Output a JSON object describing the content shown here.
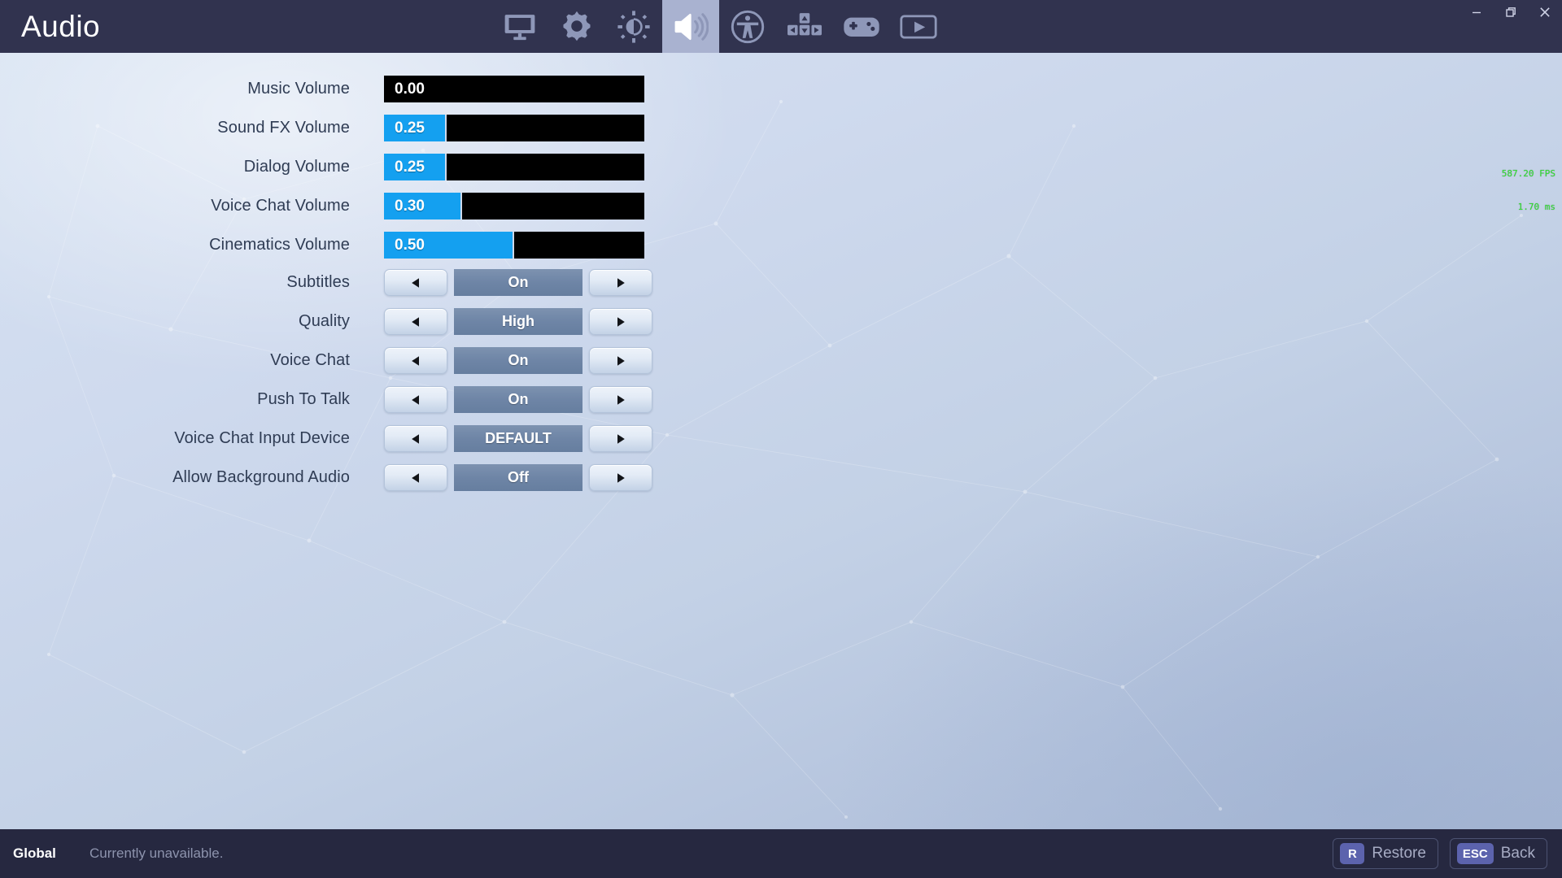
{
  "window": {
    "title": "Audio",
    "controls": [
      {
        "name": "minimize",
        "glyph": "minimize-icon"
      },
      {
        "name": "restore",
        "glyph": "restore-window-icon"
      },
      {
        "name": "close",
        "glyph": "close-icon"
      }
    ]
  },
  "nav": {
    "items": [
      {
        "id": "video",
        "icon": "monitor-icon",
        "active": false
      },
      {
        "id": "graphics",
        "icon": "gear-icon",
        "active": false
      },
      {
        "id": "brightness",
        "icon": "brightness-icon",
        "active": false
      },
      {
        "id": "audio",
        "icon": "speaker-icon",
        "active": true
      },
      {
        "id": "accessibility",
        "icon": "accessibility-icon",
        "active": false
      },
      {
        "id": "keyboard",
        "icon": "keyboard-wasd-icon",
        "active": false
      },
      {
        "id": "controller",
        "icon": "gamepad-icon",
        "active": false
      },
      {
        "id": "replay",
        "icon": "video-play-icon",
        "active": false
      }
    ]
  },
  "settings": {
    "sliders": [
      {
        "label": "Music Volume",
        "value": "0.00",
        "percent": 0
      },
      {
        "label": "Sound FX Volume",
        "value": "0.25",
        "percent": 24
      },
      {
        "label": "Dialog Volume",
        "value": "0.25",
        "percent": 24
      },
      {
        "label": "Voice Chat Volume",
        "value": "0.30",
        "percent": 30
      },
      {
        "label": "Cinematics Volume",
        "value": "0.50",
        "percent": 50
      }
    ],
    "steppers": [
      {
        "label": "Subtitles",
        "value": "On"
      },
      {
        "label": "Quality",
        "value": "High"
      },
      {
        "label": "Voice Chat",
        "value": "On"
      },
      {
        "label": "Push To Talk",
        "value": "On"
      },
      {
        "label": "Voice Chat Input Device",
        "value": "DEFAULT"
      },
      {
        "label": "Allow Background Audio",
        "value": "Off"
      }
    ],
    "prev_arrow": "◀",
    "next_arrow": "▶"
  },
  "overlay": {
    "fps": "587.20 FPS",
    "frametime": "1.70 ms",
    "fps_color": "#2ee02e"
  },
  "footer": {
    "profile": "Global",
    "status": "Currently unavailable.",
    "restore_key": "R",
    "restore_label": "Restore",
    "back_key": "ESC",
    "back_label": "Back"
  },
  "colors": {
    "topbar": "#31334f",
    "bottombar": "#262840",
    "slider_fill": "#14a0f0",
    "slider_track": "#000000",
    "stepper_value": "#6e85a6",
    "active_tab": "#a9b2d0"
  }
}
